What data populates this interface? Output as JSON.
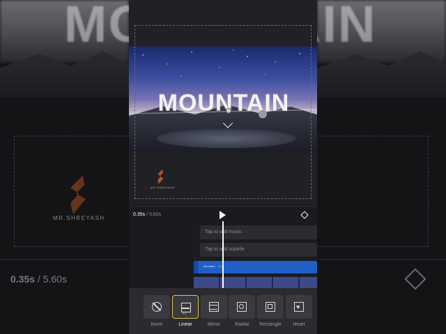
{
  "backdrop": {
    "title_left": "MO",
    "title_right": "AIN",
    "brand": "MR.SHREYASH",
    "current_time": "0.35s",
    "total_time": " / 5.60s"
  },
  "preview": {
    "title_text": "MOUNTAIN",
    "watermark": "MR.SHREYASH"
  },
  "timeline": {
    "current_time": "0.35s",
    "total_time": " / 5.60s",
    "music_placeholder": "Tap to add music",
    "subtitle_placeholder": "Tap to add subtitle",
    "text_clip_label": "Mountain",
    "text_clip_duration": "5.6s"
  },
  "tools": {
    "items": [
      {
        "label": "None",
        "icon": "no-mask-icon"
      },
      {
        "label": "Linear",
        "icon": "linear-mask-icon",
        "selected": true
      },
      {
        "label": "Mirror",
        "icon": "mirror-mask-icon"
      },
      {
        "label": "Radial",
        "icon": "radial-mask-icon"
      },
      {
        "label": "Rectangle",
        "icon": "rectangle-mask-icon"
      },
      {
        "label": "Heart",
        "icon": "heart-mask-icon"
      }
    ],
    "active_color": "#e8c34b"
  },
  "colors": {
    "text_clip": "#1f5fc9",
    "background": "#1b1b1f"
  }
}
